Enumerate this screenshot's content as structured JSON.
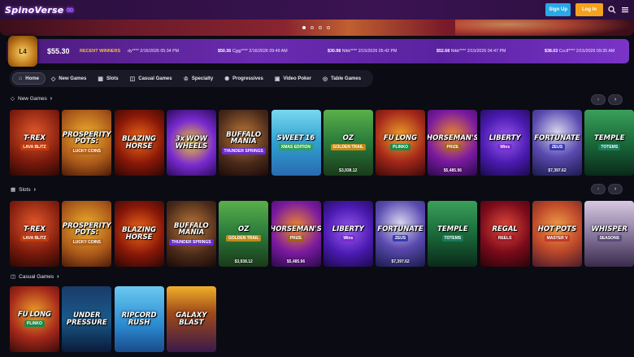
{
  "app": {
    "logo_text": "SpinoVerse",
    "signup_label": "Sign Up",
    "login_label": "Log In"
  },
  "colors": {
    "accent_signup": "#29a9e6",
    "accent_login": "#f4a21b",
    "winners_label": "#f4c430",
    "background": "#0b0b14"
  },
  "banner": {
    "slides": 4,
    "active_slide": 1
  },
  "winners_bar": {
    "jackpot_badge": "L4",
    "balance": "$55.30",
    "label": "RECENT WINNERS",
    "entries": [
      {
        "amount": "",
        "text": "dy**** 2/16/2026 05:34 PM"
      },
      {
        "amount": "$50.36",
        "text": "Cjgg**** 2/16/2026 09:49 AM"
      },
      {
        "amount": "$30.98",
        "text": "Nikk**** 2/15/2026 05:42 PM"
      },
      {
        "amount": "$52.68",
        "text": "Nikk**** 2/15/2026 04:47 PM"
      },
      {
        "amount": "$38.03",
        "text": "Cccll**** 2/15/2026 09:35 AM"
      }
    ]
  },
  "nav": {
    "items": [
      {
        "label": "Home",
        "icon": "home-icon",
        "active": true
      },
      {
        "label": "New Games",
        "icon": "diamond-icon"
      },
      {
        "label": "Slots",
        "icon": "slots-icon"
      },
      {
        "label": "Casual Games",
        "icon": "gamepad-icon"
      },
      {
        "label": "Specialty",
        "icon": "crown-icon"
      },
      {
        "label": "Progressives",
        "icon": "gear-icon"
      },
      {
        "label": "Video Poker",
        "icon": "cards-icon"
      },
      {
        "label": "Table Games",
        "icon": "table-icon"
      }
    ]
  },
  "sections": [
    {
      "title": "New Games",
      "icon": "diamond-icon",
      "games": [
        {
          "name": "T-REX",
          "sub": "LAVA BLITZ",
          "jackpot": ""
        },
        {
          "name": "PROSPERITY POTS:",
          "sub": "LUCKY COINS",
          "jackpot": ""
        },
        {
          "name": "BLAZING HORSE",
          "sub": "",
          "jackpot": ""
        },
        {
          "name": "3x WOW WHEELS",
          "sub": "",
          "jackpot": ""
        },
        {
          "name": "BUFFALO MANIA",
          "sub": "THUNDER SPRINGS",
          "jackpot": ""
        },
        {
          "name": "SWEET 16",
          "sub": "XMAS EDITION",
          "jackpot": ""
        },
        {
          "name": "OZ",
          "sub": "GOLDEN TRAIL",
          "jackpot": "$3,938.12"
        },
        {
          "name": "FU LONG",
          "sub": "PLINKO",
          "jackpot": ""
        },
        {
          "name": "HORSEMAN'S",
          "sub": "PRIZE",
          "jackpot": "$5,485.96"
        },
        {
          "name": "LIBERTY",
          "sub": "Wins",
          "jackpot": ""
        },
        {
          "name": "FORTUNATE",
          "sub": "ZEUS",
          "jackpot": "$7,397.62"
        },
        {
          "name": "TEMPLE",
          "sub": "TOTEMS",
          "jackpot": ""
        }
      ]
    },
    {
      "title": "Slots",
      "icon": "slots-icon",
      "games": [
        {
          "name": "T-REX",
          "sub": "LAVA BLITZ",
          "jackpot": ""
        },
        {
          "name": "PROSPERITY POTS:",
          "sub": "LUCKY COINS",
          "jackpot": ""
        },
        {
          "name": "BLAZING HORSE",
          "sub": "",
          "jackpot": ""
        },
        {
          "name": "BUFFALO MANIA",
          "sub": "THUNDER SPRINGS",
          "jackpot": ""
        },
        {
          "name": "OZ",
          "sub": "GOLDEN TRAIL",
          "jackpot": "$3,938.12"
        },
        {
          "name": "HORSEMAN'S",
          "sub": "PRIZE",
          "jackpot": "$5,485.96"
        },
        {
          "name": "LIBERTY",
          "sub": "Wins",
          "jackpot": ""
        },
        {
          "name": "FORTUNATE",
          "sub": "ZEUS",
          "jackpot": "$7,397.62"
        },
        {
          "name": "TEMPLE",
          "sub": "TOTEMS",
          "jackpot": ""
        },
        {
          "name": "REGAL",
          "sub": "REELS",
          "jackpot": ""
        },
        {
          "name": "HOT POTS",
          "sub": "MASTER V",
          "jackpot": ""
        },
        {
          "name": "WHISPER",
          "sub": "SEASONS",
          "jackpot": ""
        }
      ]
    },
    {
      "title": "Casual Games",
      "icon": "gamepad-icon",
      "games": [
        {
          "name": "FU LONG",
          "sub": "PLINKO",
          "jackpot": ""
        },
        {
          "name": "UNDER PRESSURE",
          "sub": "",
          "jackpot": ""
        },
        {
          "name": "RIPCORD RUSH",
          "sub": "",
          "jackpot": ""
        },
        {
          "name": "GALAXY BLAST",
          "sub": "",
          "jackpot": ""
        }
      ]
    }
  ]
}
